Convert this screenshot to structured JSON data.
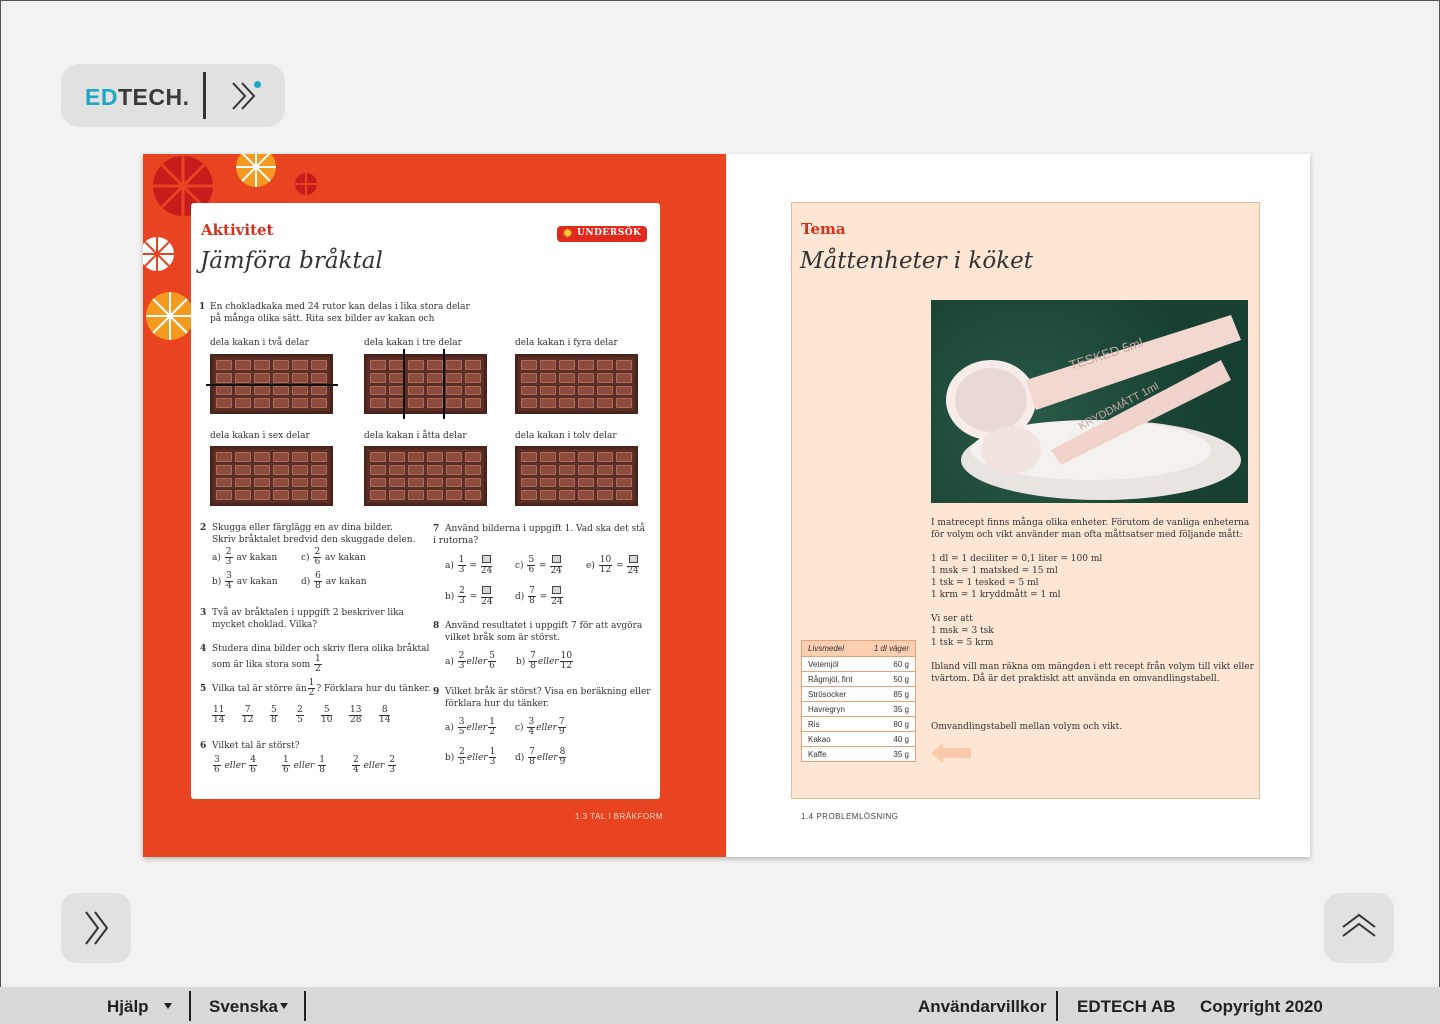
{
  "header": {
    "logo_prefix": "ED",
    "logo_suffix": "TECH."
  },
  "left_page": {
    "activity_label": "Aktivitet",
    "badge": "UNDERSÖK",
    "title": "Jämföra bråktal",
    "task1": {
      "number": "1",
      "line1": "En chokladkaka med 24 rutor kan delas i lika stora delar",
      "line2": "på många olika sätt. Rita sex bilder av kakan och"
    },
    "bars": [
      "dela kakan i två delar",
      "dela kakan i tre delar",
      "dela kakan i fyra delar",
      "dela kakan i sex delar",
      "dela kakan i åtta delar",
      "dela kakan i tolv delar"
    ],
    "task2": {
      "number": "2",
      "line1": "Skugga eller färglägg en av dina bilder.",
      "line2": "Skriv bråktalet bredvid den skuggade delen.",
      "suffix": "av kakan",
      "labels": [
        "a)",
        "c)",
        "b)",
        "d)"
      ],
      "fracs": [
        [
          "2",
          "3"
        ],
        [
          "2",
          "6"
        ],
        [
          "3",
          "4"
        ],
        [
          "6",
          "8"
        ]
      ]
    },
    "task3": {
      "number": "3",
      "line1": "Två av bråktalen i uppgift 2 beskriver lika",
      "line2": "mycket choklad. Vilka?"
    },
    "task4": {
      "number": "4",
      "line1": "Studera dina bilder och skriv flera olika bråktal",
      "line2": "som är lika stora som",
      "frac": [
        "1",
        "2"
      ]
    },
    "task5": {
      "number": "5",
      "pre": "Vilka tal är större än",
      "post": "? Förklara hur du tänker.",
      "frac": [
        "1",
        "2"
      ],
      "list": [
        [
          "11",
          "14"
        ],
        [
          "7",
          "12"
        ],
        [
          "5",
          "8"
        ],
        [
          "2",
          "5"
        ],
        [
          "5",
          "10"
        ],
        [
          "13",
          "28"
        ],
        [
          "8",
          "14"
        ]
      ]
    },
    "task6": {
      "number": "6",
      "line1": "Vilket tal är störst?",
      "word": "eller",
      "pairs": [
        [
          [
            "3",
            "6"
          ],
          [
            "4",
            "6"
          ]
        ],
        [
          [
            "1",
            "6"
          ],
          [
            "1",
            "8"
          ]
        ],
        [
          [
            "2",
            "4"
          ],
          [
            "2",
            "3"
          ]
        ]
      ]
    },
    "task7": {
      "number": "7",
      "line1": "Använd bilderna i uppgift 1. Vad ska det stå",
      "line2": "i rutorna?",
      "items": [
        {
          "label": "a)",
          "f": [
            "1",
            "3"
          ],
          "d": "24"
        },
        {
          "label": "c)",
          "f": [
            "5",
            "6"
          ],
          "d": "24"
        },
        {
          "label": "e)",
          "f": [
            "10",
            "12"
          ],
          "d": "24"
        },
        {
          "label": "b)",
          "f": [
            "2",
            "3"
          ],
          "d": "24"
        },
        {
          "label": "d)",
          "f": [
            "7",
            "8"
          ],
          "d": "24"
        }
      ]
    },
    "task8": {
      "number": "8",
      "line1": "Använd resultatet i uppgift 7 för att avgöra",
      "line2": "vilket bråk som är störst.",
      "items": [
        {
          "label": "a)",
          "a": [
            "2",
            "3"
          ],
          "b": [
            "5",
            "6"
          ]
        },
        {
          "label": "b)",
          "a": [
            "7",
            "8"
          ],
          "b": [
            "10",
            "12"
          ]
        }
      ]
    },
    "task9": {
      "number": "9",
      "line1": "Vilket bråk är störst? Visa en beräkning eller",
      "line2": "förklara hur du tänker.",
      "items": [
        {
          "label": "a)",
          "a": [
            "3",
            "5"
          ],
          "b": [
            "1",
            "2"
          ]
        },
        {
          "label": "c)",
          "a": [
            "3",
            "4"
          ],
          "b": [
            "7",
            "9"
          ]
        },
        {
          "label": "b)",
          "a": [
            "2",
            "5"
          ],
          "b": [
            "1",
            "3"
          ]
        },
        {
          "label": "d)",
          "a": [
            "7",
            "8"
          ],
          "b": [
            "8",
            "9"
          ]
        }
      ]
    },
    "footer": "1.3 TAL I BRÅKFORM"
  },
  "right_page": {
    "label": "Tema",
    "title": "Måttenheter i köket",
    "intro1": "I matrecept finns många olika enheter. Förutom de vanliga enheterna",
    "intro2": "för volym och vikt använder man ofta måttsatser med följande mått:",
    "units": [
      "1 dl = 1 deciliter = 0,1 liter = 100 ml",
      "1 msk = 1 matsked = 15 ml",
      "1 tsk = 1 tesked = 5 ml",
      "1 krm = 1 kryddmått = 1 ml"
    ],
    "see": [
      "Vi ser att",
      "1 msk = 3 tsk",
      "1 tsk = 5 krm"
    ],
    "conv1": "Ibland vill man räkna om mängden i ett recept från volym till vikt eller",
    "conv2": "tvärtom. Då är det praktiskt att använda en omvandlingstabell.",
    "table_caption": "Omvandlingstabell mellan volym och vikt.",
    "table_header": [
      "Livsmedel",
      "1 dl väger"
    ],
    "table_rows": [
      [
        "Vetemjöl",
        "60 g"
      ],
      [
        "Rågmjöl, fint",
        "50 g"
      ],
      [
        "Strösocker",
        "85 g"
      ],
      [
        "Havregryn",
        "35 g"
      ],
      [
        "Ris",
        "80 g"
      ],
      [
        "Kakao",
        "40 g"
      ],
      [
        "Kaffe",
        "35 g"
      ]
    ],
    "photo_labels": [
      "TESKED 5ml",
      "KRYDDMÅTT 1ml"
    ],
    "footer": "1.4 PROBLEMLÖSNING"
  },
  "footer": {
    "help": "Hjälp",
    "language": "Svenska",
    "terms": "Användarvillkor",
    "company": "EDTECH AB",
    "copyright": "Copyright 2020"
  },
  "colors": {
    "accent": "#1fa8c4",
    "page_red": "#e84421",
    "tema_bg": "#fde7d4"
  },
  "icons": [
    "double-chevron-right-icon",
    "double-chevron-up-icon",
    "caret-down-icon",
    "left-arrow-icon",
    "star-icon"
  ]
}
